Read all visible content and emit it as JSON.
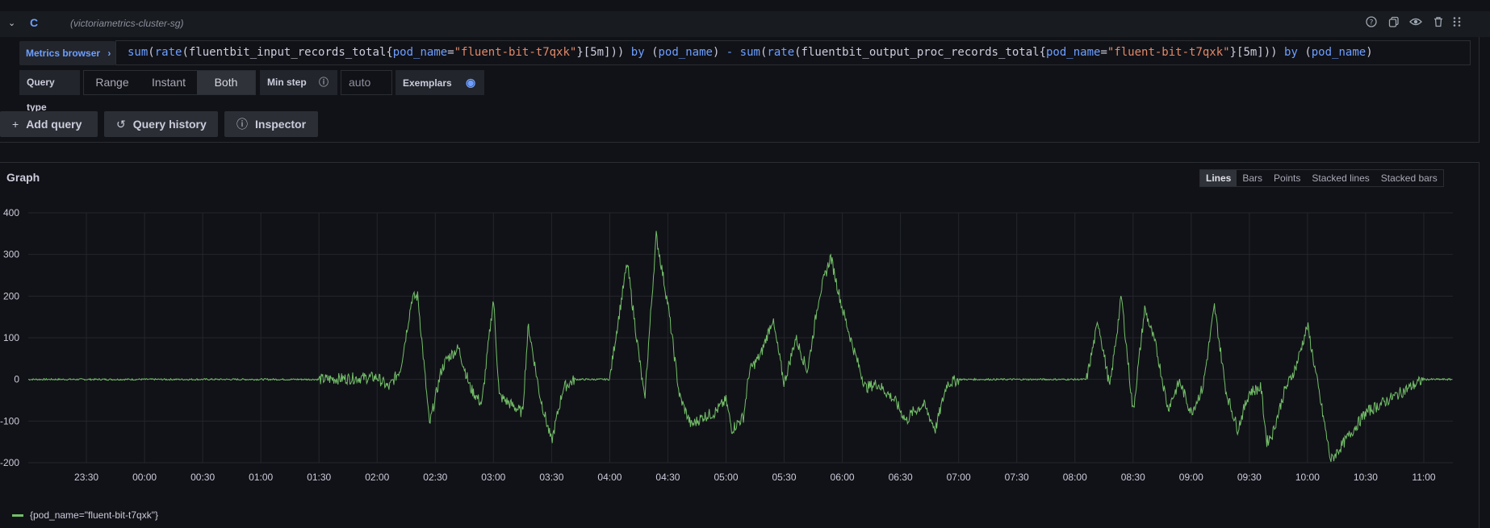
{
  "query_row": {
    "collapse_icon": "chevron-down-icon",
    "ref_id": "C",
    "datasource": "(victoriametrics-cluster-sg)",
    "header_icons": [
      "help-icon",
      "copy-icon",
      "eye-icon",
      "trash-icon",
      "drag-handle-icon"
    ]
  },
  "editor": {
    "metrics_browser_label": "Metrics browser",
    "query_tokens": [
      {
        "t": "sum",
        "c": "fn"
      },
      {
        "t": "(",
        "c": ""
      },
      {
        "t": "rate",
        "c": "fn"
      },
      {
        "t": "(fluentbit_input_records_total{",
        "c": ""
      },
      {
        "t": "pod_name",
        "c": "lbl"
      },
      {
        "t": "=",
        "c": ""
      },
      {
        "t": "\"fluent-bit-t7qxk\"",
        "c": "str"
      },
      {
        "t": "}[5m])) ",
        "c": ""
      },
      {
        "t": "by",
        "c": "kw"
      },
      {
        "t": " (",
        "c": ""
      },
      {
        "t": "pod_name",
        "c": "lbl"
      },
      {
        "t": ") ",
        "c": ""
      },
      {
        "t": "-",
        "c": "op"
      },
      {
        "t": " ",
        "c": ""
      },
      {
        "t": "sum",
        "c": "fn"
      },
      {
        "t": "(",
        "c": ""
      },
      {
        "t": "rate",
        "c": "fn"
      },
      {
        "t": "(fluentbit_output_proc_records_total{",
        "c": ""
      },
      {
        "t": "pod_name",
        "c": "lbl"
      },
      {
        "t": "=",
        "c": ""
      },
      {
        "t": "\"fluent-bit-t7qxk\"",
        "c": "str"
      },
      {
        "t": "}[5m])) ",
        "c": ""
      },
      {
        "t": "by",
        "c": "kw"
      },
      {
        "t": " (",
        "c": ""
      },
      {
        "t": "pod_name",
        "c": "lbl"
      },
      {
        "t": ")",
        "c": ""
      }
    ]
  },
  "options": {
    "query_type_label": "Query type",
    "query_types": [
      "Range",
      "Instant",
      "Both"
    ],
    "query_type_selected": "Both",
    "min_step_label": "Min step",
    "min_step_placeholder": "auto",
    "exemplars_label": "Exemplars"
  },
  "actions": {
    "add_query": "Add query",
    "query_history": "Query history",
    "inspector": "Inspector"
  },
  "graph": {
    "title": "Graph",
    "view_modes": [
      "Lines",
      "Bars",
      "Points",
      "Stacked lines",
      "Stacked bars"
    ],
    "view_selected": "Lines",
    "legend_label": "{pod_name=\"fluent-bit-t7qxk\"}",
    "series_color": "#73bf69"
  },
  "chart_data": {
    "type": "line",
    "title": "",
    "xlabel": "",
    "ylabel": "",
    "ylim": [
      -200,
      400
    ],
    "y_ticks": [
      400,
      300,
      200,
      100,
      0,
      -100,
      -200
    ],
    "x_tick_labels": [
      "23:30",
      "00:00",
      "00:30",
      "01:00",
      "01:30",
      "02:00",
      "02:30",
      "03:00",
      "03:30",
      "04:00",
      "04:30",
      "05:00",
      "05:30",
      "06:00",
      "06:30",
      "07:00",
      "07:30",
      "08:00",
      "08:30",
      "09:00",
      "09:30",
      "10:00",
      "10:30",
      "11:00"
    ],
    "x_range_hours": [
      23.0,
      35.25
    ],
    "grid": true,
    "legend": "bottom-left",
    "series": [
      {
        "name": "{pod_name=\"fluent-bit-t7qxk\"}",
        "x": [
          23.0,
          23.5,
          24.0,
          24.5,
          25.0,
          25.5,
          26.0,
          26.1,
          26.2,
          26.3,
          26.35,
          26.45,
          26.55,
          26.6,
          26.7,
          26.8,
          26.9,
          27.0,
          27.05,
          27.15,
          27.25,
          27.3,
          27.4,
          27.5,
          27.6,
          27.7,
          27.8,
          27.9,
          28.0,
          28.05,
          28.15,
          28.3,
          28.4,
          28.5,
          28.6,
          28.7,
          28.8,
          28.9,
          29.0,
          29.05,
          29.15,
          29.2,
          29.3,
          29.4,
          29.5,
          29.6,
          29.7,
          29.8,
          29.9,
          30.0,
          30.1,
          30.2,
          30.3,
          30.45,
          30.55,
          30.6,
          30.7,
          30.8,
          30.9,
          31.0,
          31.1,
          31.2,
          31.4,
          31.6,
          31.8,
          32.0,
          32.1,
          32.2,
          32.3,
          32.4,
          32.5,
          32.6,
          32.7,
          32.8,
          32.9,
          33.0,
          33.1,
          33.2,
          33.3,
          33.4,
          33.5,
          33.6,
          33.65,
          33.7,
          33.8,
          33.9,
          34.0,
          34.2,
          34.5,
          35.0,
          35.25
        ],
        "y": [
          0,
          0,
          0,
          0,
          0,
          0,
          5,
          -20,
          25,
          195,
          200,
          -110,
          20,
          50,
          75,
          -20,
          -60,
          195,
          -40,
          -60,
          -80,
          130,
          -40,
          -150,
          -20,
          0,
          0,
          0,
          0,
          100,
          280,
          -50,
          345,
          180,
          -40,
          -110,
          -90,
          -80,
          -50,
          -120,
          -90,
          20,
          60,
          145,
          -10,
          100,
          20,
          200,
          295,
          170,
          70,
          -20,
          -10,
          -50,
          -100,
          -80,
          -60,
          -120,
          -10,
          0,
          0,
          0,
          0,
          0,
          0,
          0,
          0,
          140,
          -20,
          200,
          -80,
          170,
          75,
          -70,
          -5,
          -80,
          -20,
          175,
          -30,
          -120,
          -30,
          -20,
          -150,
          -130,
          -30,
          30,
          130,
          -195,
          -80,
          0,
          0
        ]
      }
    ]
  }
}
